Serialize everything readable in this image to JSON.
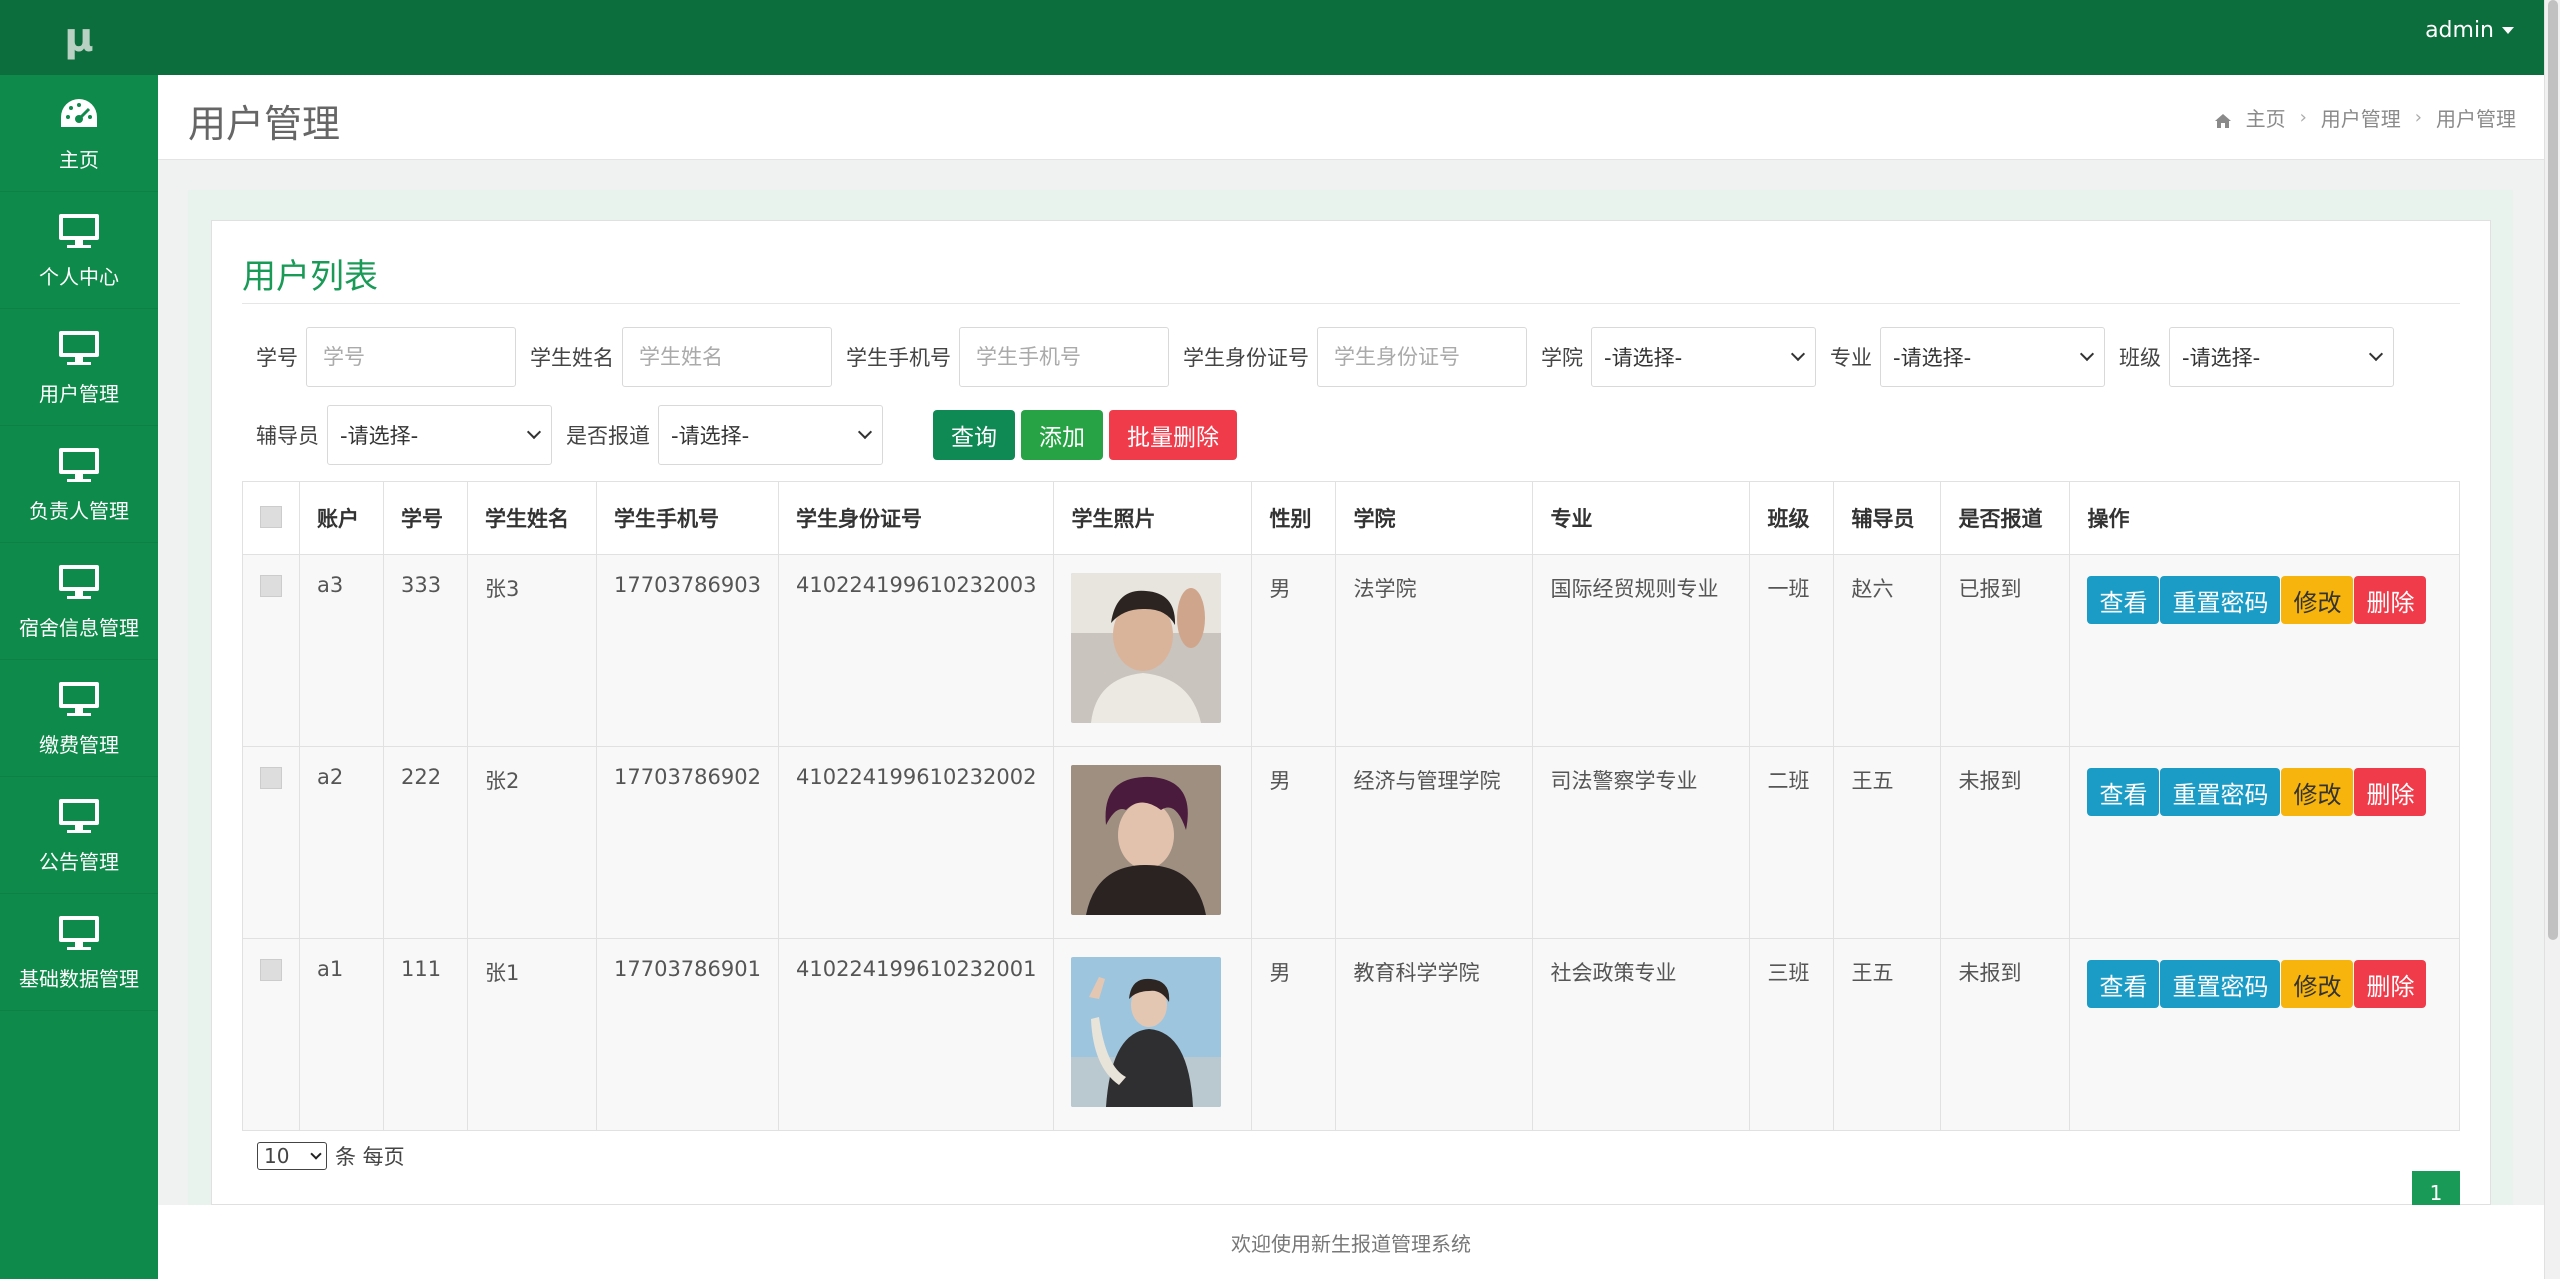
{
  "app": {
    "logo": "μ",
    "user": "admin"
  },
  "sidebar": {
    "items": [
      {
        "label": "主页",
        "icon": "dashboard-icon"
      },
      {
        "label": "个人中心",
        "icon": "monitor-icon"
      },
      {
        "label": "用户管理",
        "icon": "monitor-icon"
      },
      {
        "label": "负责人管理",
        "icon": "monitor-icon"
      },
      {
        "label": "宿舍信息管理",
        "icon": "monitor-icon"
      },
      {
        "label": "缴费管理",
        "icon": "monitor-icon"
      },
      {
        "label": "公告管理",
        "icon": "monitor-icon"
      },
      {
        "label": "基础数据管理",
        "icon": "monitor-icon"
      }
    ]
  },
  "header": {
    "page_title": "用户管理",
    "breadcrumb": [
      "主页",
      "用户管理",
      "用户管理"
    ]
  },
  "panel": {
    "title": "用户列表"
  },
  "search": {
    "student_no_label": "学号",
    "student_no_placeholder": "学号",
    "student_name_label": "学生姓名",
    "student_name_placeholder": "学生姓名",
    "phone_label": "学生手机号",
    "phone_placeholder": "学生手机号",
    "idcard_label": "学生身份证号",
    "idcard_placeholder": "学生身份证号",
    "college_label": "学院",
    "college_value": "-请选择-",
    "major_label": "专业",
    "major_value": "-请选择-",
    "class_label": "班级",
    "class_value": "-请选择-",
    "counselor_label": "辅导员",
    "counselor_value": "-请选择-",
    "reported_label": "是否报道",
    "reported_value": "-请选择-",
    "query_btn": "查询",
    "add_btn": "添加",
    "batch_delete_btn": "批量删除"
  },
  "table": {
    "columns": [
      "账户",
      "学号",
      "学生姓名",
      "学生手机号",
      "学生身份证号",
      "学生照片",
      "性别",
      "学院",
      "专业",
      "班级",
      "辅导员",
      "是否报道",
      "操作"
    ],
    "rows": [
      {
        "account": "a3",
        "no": "333",
        "name": "张3",
        "phone": "17703786903",
        "idcard": "410224199610232003",
        "gender": "男",
        "college": "法学院",
        "major": "国际经贸规则专业",
        "class": "一班",
        "counselor": "赵六",
        "reported": "已报到"
      },
      {
        "account": "a2",
        "no": "222",
        "name": "张2",
        "phone": "17703786902",
        "idcard": "410224199610232002",
        "gender": "男",
        "college": "经济与管理学院",
        "major": "司法警察学专业",
        "class": "二班",
        "counselor": "王五",
        "reported": "未报到"
      },
      {
        "account": "a1",
        "no": "111",
        "name": "张1",
        "phone": "17703786901",
        "idcard": "410224199610232001",
        "gender": "男",
        "college": "教育科学学院",
        "major": "社会政策专业",
        "class": "三班",
        "counselor": "王五",
        "reported": "未报到"
      }
    ],
    "ops": {
      "view": "查看",
      "reset": "重置密码",
      "edit": "修改",
      "delete": "删除"
    }
  },
  "pager": {
    "page_size": "10",
    "page_size_suffix": "条 每页",
    "current_page": "1"
  },
  "footer": {
    "text": "欢迎使用新生报道管理系统"
  },
  "colors": {
    "sidebar": "#0e8a4a",
    "topbar": "#0c6e3c",
    "accent": "#1a9a57",
    "danger": "#f03c4a",
    "info": "#1a9cc7",
    "warning": "#f6b40c"
  }
}
